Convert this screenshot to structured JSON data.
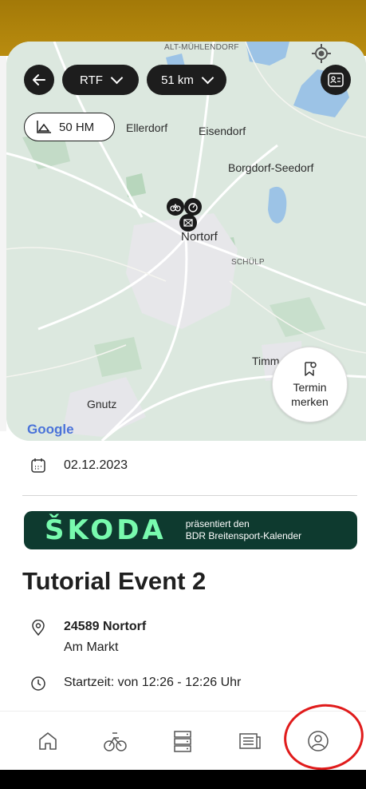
{
  "map": {
    "labels": {
      "alt_muhlendorf": "ALT-MÜHLENDORF",
      "ellerdorf": "Ellerdorf",
      "eisendorf": "Eisendorf",
      "borgdorf": "Borgdorf-Seedorf",
      "nortorf": "Nortorf",
      "schulp": "SCHÜLP",
      "timm": "Timm",
      "gnutz": "Gnutz"
    },
    "google_logo": "Google"
  },
  "filters": {
    "type": "RTF",
    "distance": "51 km",
    "elevation": "50 HM"
  },
  "termin_button": {
    "line1": "Termin",
    "line2": "merken"
  },
  "event": {
    "date": "02.12.2023",
    "title": "Tutorial Event 2",
    "postal_city": "24589 Nortorf",
    "street": "Am Markt",
    "start_time": "Startzeit: von 12:26 - 12:26 Uhr"
  },
  "banner": {
    "brand": "ŠKODA",
    "subtitle_line1": "präsentiert den",
    "subtitle_line2": "BDR Breitensport-Kalender"
  },
  "colors": {
    "accent_gold": "#b38a0d",
    "banner_bg": "#0e3a2f",
    "brand_green": "#78faae",
    "highlight_red": "#e01b1b"
  },
  "nav": {
    "items": [
      "home-icon",
      "cyclist-icon",
      "list-icon",
      "news-icon",
      "profile-icon"
    ]
  }
}
